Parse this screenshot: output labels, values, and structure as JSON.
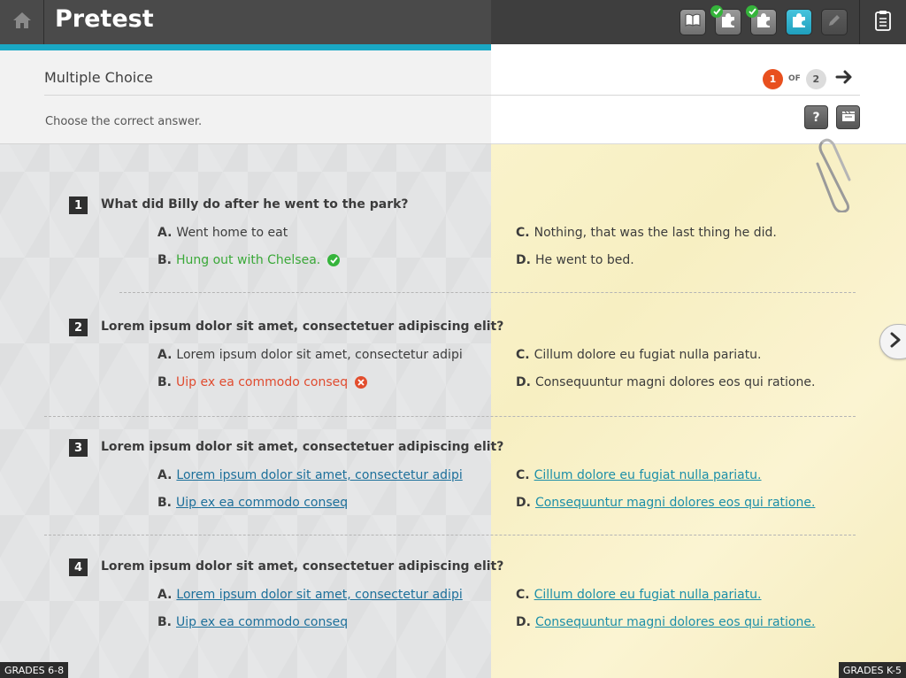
{
  "app": {
    "title": "Pretest"
  },
  "toolbar": {
    "icons": [
      "book-icon",
      "puzzle-icon",
      "puzzle-icon",
      "puzzle-icon",
      "pencil-icon",
      "clipboard-icon"
    ]
  },
  "header": {
    "section_title": "Multiple Choice",
    "instructions": "Choose the correct answer.",
    "pager": {
      "current": "1",
      "of_label": "OF",
      "total": "2"
    },
    "help_label": "?"
  },
  "questions": [
    {
      "number": "1",
      "text": "What did Billy do after he went to the park?",
      "options": [
        {
          "letter": "A.",
          "text": "Went home to eat",
          "state": "plain"
        },
        {
          "letter": "B.",
          "text": "Hung out with Chelsea.",
          "state": "correct"
        },
        {
          "letter": "C.",
          "text": "Nothing, that was the last thing he did.",
          "state": "plain"
        },
        {
          "letter": "D.",
          "text": "He went to bed.",
          "state": "plain"
        }
      ]
    },
    {
      "number": "2",
      "text": "Lorem ipsum dolor sit amet, consectetuer adipiscing elit?",
      "options": [
        {
          "letter": "A.",
          "text": "Lorem ipsum dolor sit amet, consectetur adipi",
          "state": "plain"
        },
        {
          "letter": "B.",
          "text": "Uip ex ea commodo conseq",
          "state": "wrong"
        },
        {
          "letter": "C.",
          "text": "Cillum dolore eu fugiat nulla pariatu.",
          "state": "plain"
        },
        {
          "letter": "D.",
          "text": "Consequuntur magni dolores eos qui ratione.",
          "state": "plain"
        }
      ]
    },
    {
      "number": "3",
      "text": "Lorem ipsum dolor sit amet, consectetuer adipiscing elit?",
      "options": [
        {
          "letter": "A.",
          "text": "Lorem ipsum dolor sit amet, consectetur adipi",
          "state": "link"
        },
        {
          "letter": "B.",
          "text": "Uip ex ea commodo conseq",
          "state": "link"
        },
        {
          "letter": "C.",
          "text": "Cillum dolore eu fugiat nulla pariatu.",
          "state": "link"
        },
        {
          "letter": "D.",
          "text": "Consequuntur magni dolores eos qui ratione.",
          "state": "link"
        }
      ]
    },
    {
      "number": "4",
      "text": "Lorem ipsum dolor sit amet, consectetuer adipiscing elit?",
      "options": [
        {
          "letter": "A.",
          "text": "Lorem ipsum dolor sit amet, consectetur adipi",
          "state": "link"
        },
        {
          "letter": "B.",
          "text": "Uip ex ea commodo conseq",
          "state": "link"
        },
        {
          "letter": "C.",
          "text": "Cillum dolore eu fugiat nulla pariatu.",
          "state": "link"
        },
        {
          "letter": "D.",
          "text": "Consequuntur magni dolores eos qui ratione.",
          "state": "link"
        }
      ]
    }
  ],
  "footer": {
    "left_badge": "GRADES 6-8",
    "right_badge": "GRADES K-5"
  },
  "colors": {
    "accent": "#1aa8c4",
    "current_page": "#e8501e",
    "correct": "#3aa838",
    "wrong": "#e04b2f",
    "link": "#1c6f9a"
  }
}
